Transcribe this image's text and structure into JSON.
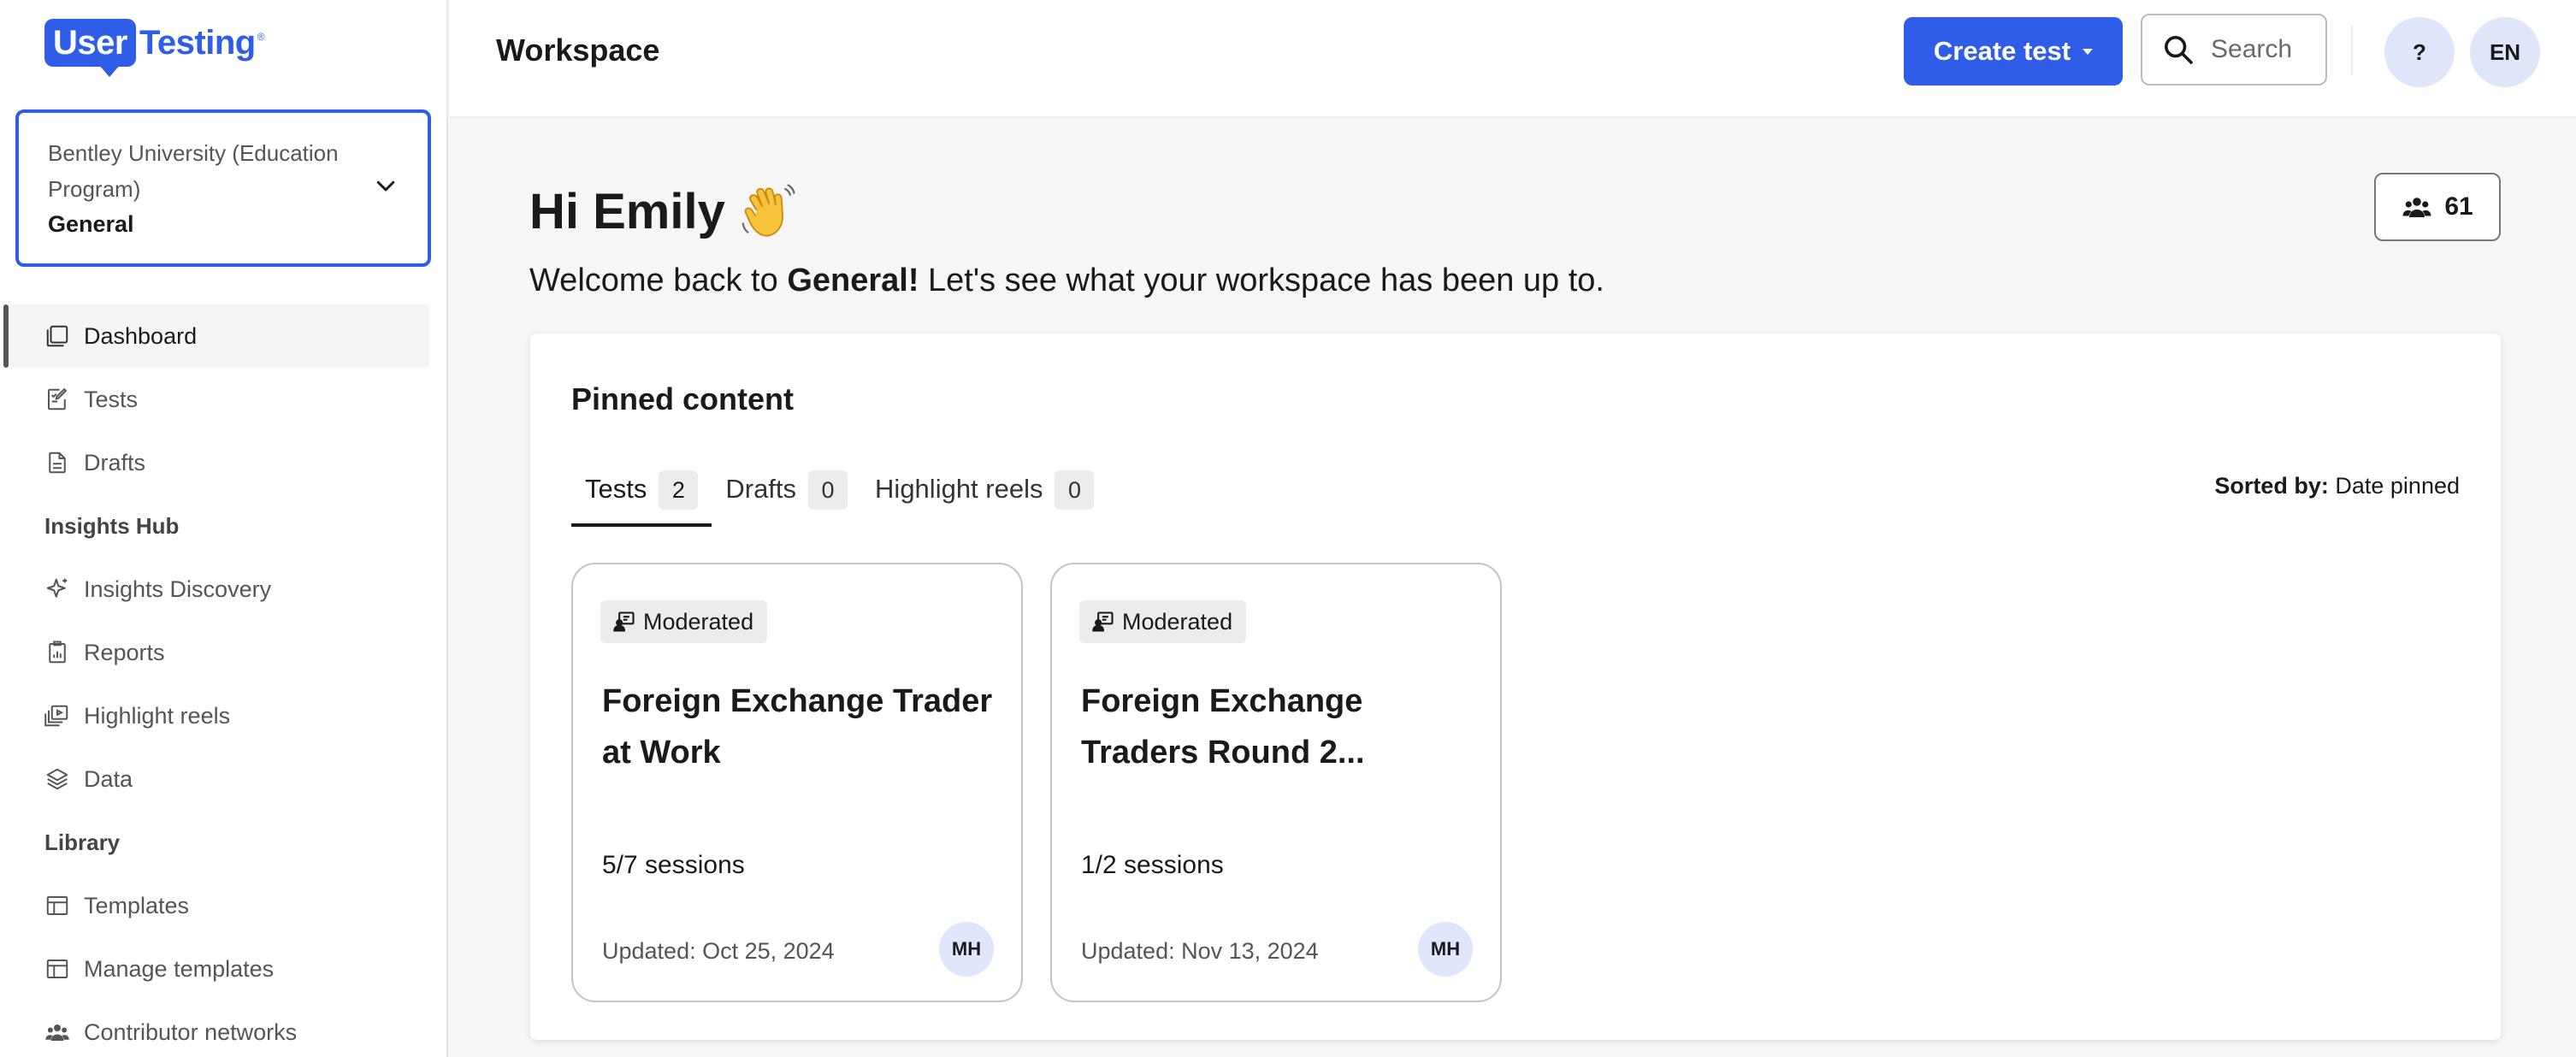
{
  "brand": {
    "logo_user": "User",
    "logo_testing": "Testing",
    "logo_reg": "®",
    "accent": "#2f5de8"
  },
  "workspace_select": {
    "org": "Bentley University (Education Program)",
    "name": "General"
  },
  "sidebar": {
    "items": [
      {
        "label": "Dashboard",
        "icon": "dashboard-icon",
        "active": true
      },
      {
        "label": "Tests",
        "icon": "tests-icon"
      },
      {
        "label": "Drafts",
        "icon": "drafts-icon"
      }
    ],
    "insights_section": "Insights Hub",
    "insights_items": [
      {
        "label": "Insights Discovery",
        "icon": "sparkle-icon"
      },
      {
        "label": "Reports",
        "icon": "reports-icon"
      },
      {
        "label": "Highlight reels",
        "icon": "highlight-reels-icon"
      },
      {
        "label": "Data",
        "icon": "layers-icon"
      }
    ],
    "library_section": "Library",
    "library_items": [
      {
        "label": "Templates",
        "icon": "template-icon"
      },
      {
        "label": "Manage templates",
        "icon": "template-icon"
      },
      {
        "label": "Contributor networks",
        "icon": "people-icon"
      }
    ]
  },
  "header": {
    "title": "Workspace",
    "create_label": "Create test",
    "search_placeholder": "Search",
    "help_label": "?",
    "lang_label": "EN"
  },
  "main": {
    "greeting": "Hi Emily",
    "welcome_prefix": "Welcome back to ",
    "welcome_bold": "General!",
    "welcome_suffix": " Let's see what your workspace has been up to.",
    "members_count": "61"
  },
  "pinned": {
    "title": "Pinned content",
    "tabs": [
      {
        "label": "Tests",
        "count": "2",
        "active": true
      },
      {
        "label": "Drafts",
        "count": "0"
      },
      {
        "label": "Highlight reels",
        "count": "0"
      }
    ],
    "sorted_label": "Sorted by:",
    "sorted_value": "Date pinned",
    "cards": [
      {
        "badge": "Moderated",
        "title": "Foreign Exchange Trader at Work",
        "sessions": "5/7 sessions",
        "updated": "Updated: Oct 25, 2024",
        "avatar": "MH"
      },
      {
        "badge": "Moderated",
        "title": "Foreign Exchange Traders Round 2...",
        "sessions": "1/2 sessions",
        "updated": "Updated: Nov 13, 2024",
        "avatar": "MH"
      }
    ]
  }
}
